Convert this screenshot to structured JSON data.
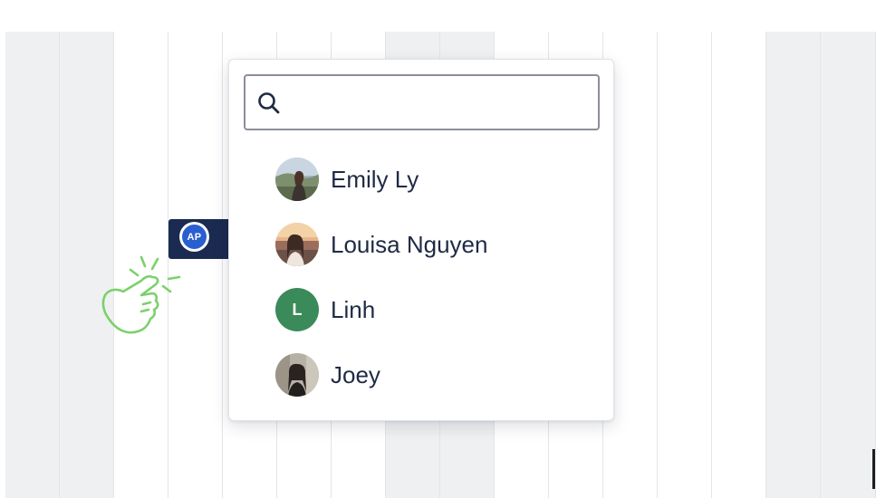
{
  "chip": {
    "initials": "AP"
  },
  "search": {
    "value": "",
    "placeholder": ""
  },
  "options": [
    {
      "name": "Emily Ly",
      "avatar": "photo"
    },
    {
      "name": "Louisa Nguyen",
      "avatar": "photo"
    },
    {
      "name": "Linh",
      "avatar": "initial",
      "initial": "L"
    },
    {
      "name": "Joey",
      "avatar": "photo"
    }
  ],
  "colors": {
    "chip_bg": "#1b2a50",
    "chip_avatar": "#2a5fd0",
    "initial_avatar": "#3b8a5a",
    "pointer": "#7bd16a",
    "grid_shade": "#eff0f2"
  },
  "icons": [
    "search-icon",
    "pointing-hand-icon"
  ]
}
